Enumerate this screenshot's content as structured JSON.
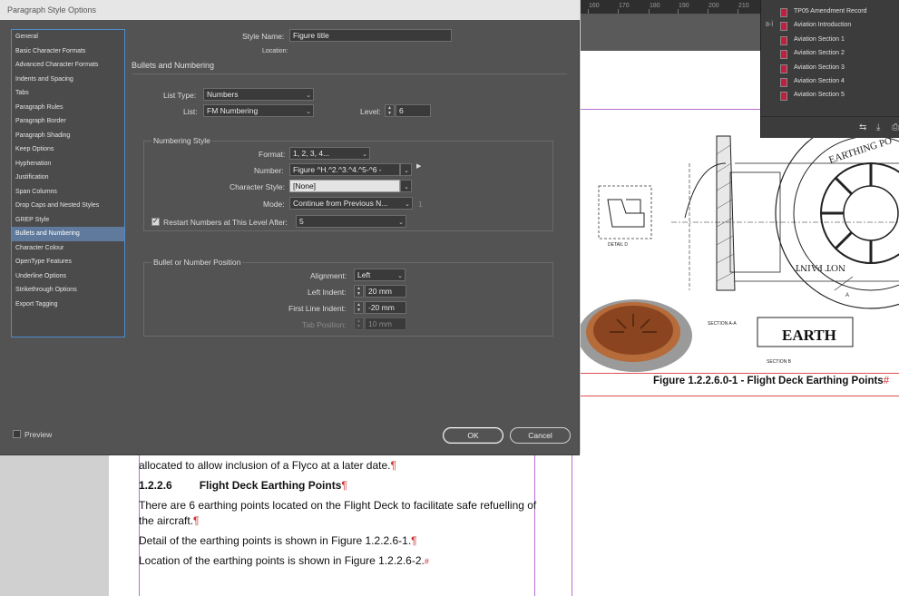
{
  "ruler": {
    "labels": [
      "160",
      "170",
      "180",
      "190",
      "200",
      "210"
    ]
  },
  "document": {
    "lines": [
      {
        "text": "allocated to allow inclusion of a Flyco at a later date.",
        "mark": "¶"
      },
      {
        "number": "1.2.2.6",
        "heading": "Flight Deck Earthing Points",
        "mark": "¶"
      },
      {
        "text": "There are 6 earthing points located on the Flight Deck to facilitate safe refuelling of",
        "mark": ""
      },
      {
        "text": "the aircraft.",
        "mark": "¶"
      },
      {
        "text": "Detail of the earthing points is shown in Figure 1.2.2.6-1.",
        "mark": "¶"
      },
      {
        "text": "Location of the earthing points is shown in Figure 1.2.2.6-2.",
        "mark": "#"
      }
    ],
    "figure_caption": "Figure 1.2.2.6.0-1 - Flight Deck Earthing Points",
    "figure_caption_mark": "#",
    "drawing_text": {
      "earthing_point": "EARTHING PO",
      "not_paint": "NOT PAINT",
      "earth_label": "EARTH",
      "section_aa": "SECTION A-A",
      "section_b": "SECTION B"
    }
  },
  "pages_panel": {
    "items": [
      {
        "label": "TP05 Amendment Record",
        "icon": "page-icon"
      },
      {
        "label": "Aviation Introduction",
        "icon": "page-icon",
        "linked": true
      },
      {
        "label": "Aviation Section 1",
        "icon": "page-icon"
      },
      {
        "label": "Aviation Section 2",
        "icon": "page-icon"
      },
      {
        "label": "Aviation Section 3",
        "icon": "page-icon"
      },
      {
        "label": "Aviation Section 4",
        "icon": "page-icon"
      },
      {
        "label": "Aviation Section 5",
        "icon": "page-icon"
      }
    ],
    "link_icon_text": "8-Ì",
    "footer_icons": [
      "relink-icon",
      "import-icon",
      "print-icon"
    ]
  },
  "dialog": {
    "title": "Paragraph Style Options",
    "sidebar": [
      "General",
      "Basic Character Formats",
      "Advanced Character Formats",
      "Indents and Spacing",
      "Tabs",
      "Paragraph Rules",
      "Paragraph Border",
      "Paragraph Shading",
      "Keep Options",
      "Hyphenation",
      "Justification",
      "Span Columns",
      "Drop Caps and Nested Styles",
      "GREP Style",
      "Bullets and Numbering",
      "Character Colour",
      "OpenType Features",
      "Underline Options",
      "Strikethrough Options",
      "Export Tagging"
    ],
    "selected_index": 14,
    "style_name_label": "Style Name:",
    "style_name_value": "Figure title",
    "location_label": "Location:",
    "section_title": "Bullets and Numbering",
    "list_type_label": "List Type:",
    "list_type_value": "Numbers",
    "list_label": "List:",
    "list_value": "FM Numbering",
    "level_label": "Level:",
    "level_value": "6",
    "numbering_style": {
      "title": "Numbering Style",
      "format_label": "Format:",
      "format_value": "1, 2, 3, 4...",
      "number_label": "Number:",
      "number_value": "Figure ^H.^2.^3.^4.^5-^6 -",
      "char_style_label": "Character Style:",
      "char_style_value": "[None]",
      "mode_label": "Mode:",
      "mode_value": "Continue from Previous N...",
      "mode_side": "1",
      "restart_label": "Restart Numbers at This Level After:",
      "restart_checked": true,
      "restart_value": "5"
    },
    "position": {
      "title": "Bullet or Number Position",
      "alignment_label": "Alignment:",
      "alignment_value": "Left",
      "left_indent_label": "Left Indent:",
      "left_indent_value": "20 mm",
      "first_line_label": "First Line Indent:",
      "first_line_value": "-20 mm",
      "tab_position_label": "Tab Position:",
      "tab_position_value": "10 mm"
    },
    "preview_label": "Preview",
    "preview_checked": false,
    "ok_label": "OK",
    "cancel_label": "Cancel"
  }
}
